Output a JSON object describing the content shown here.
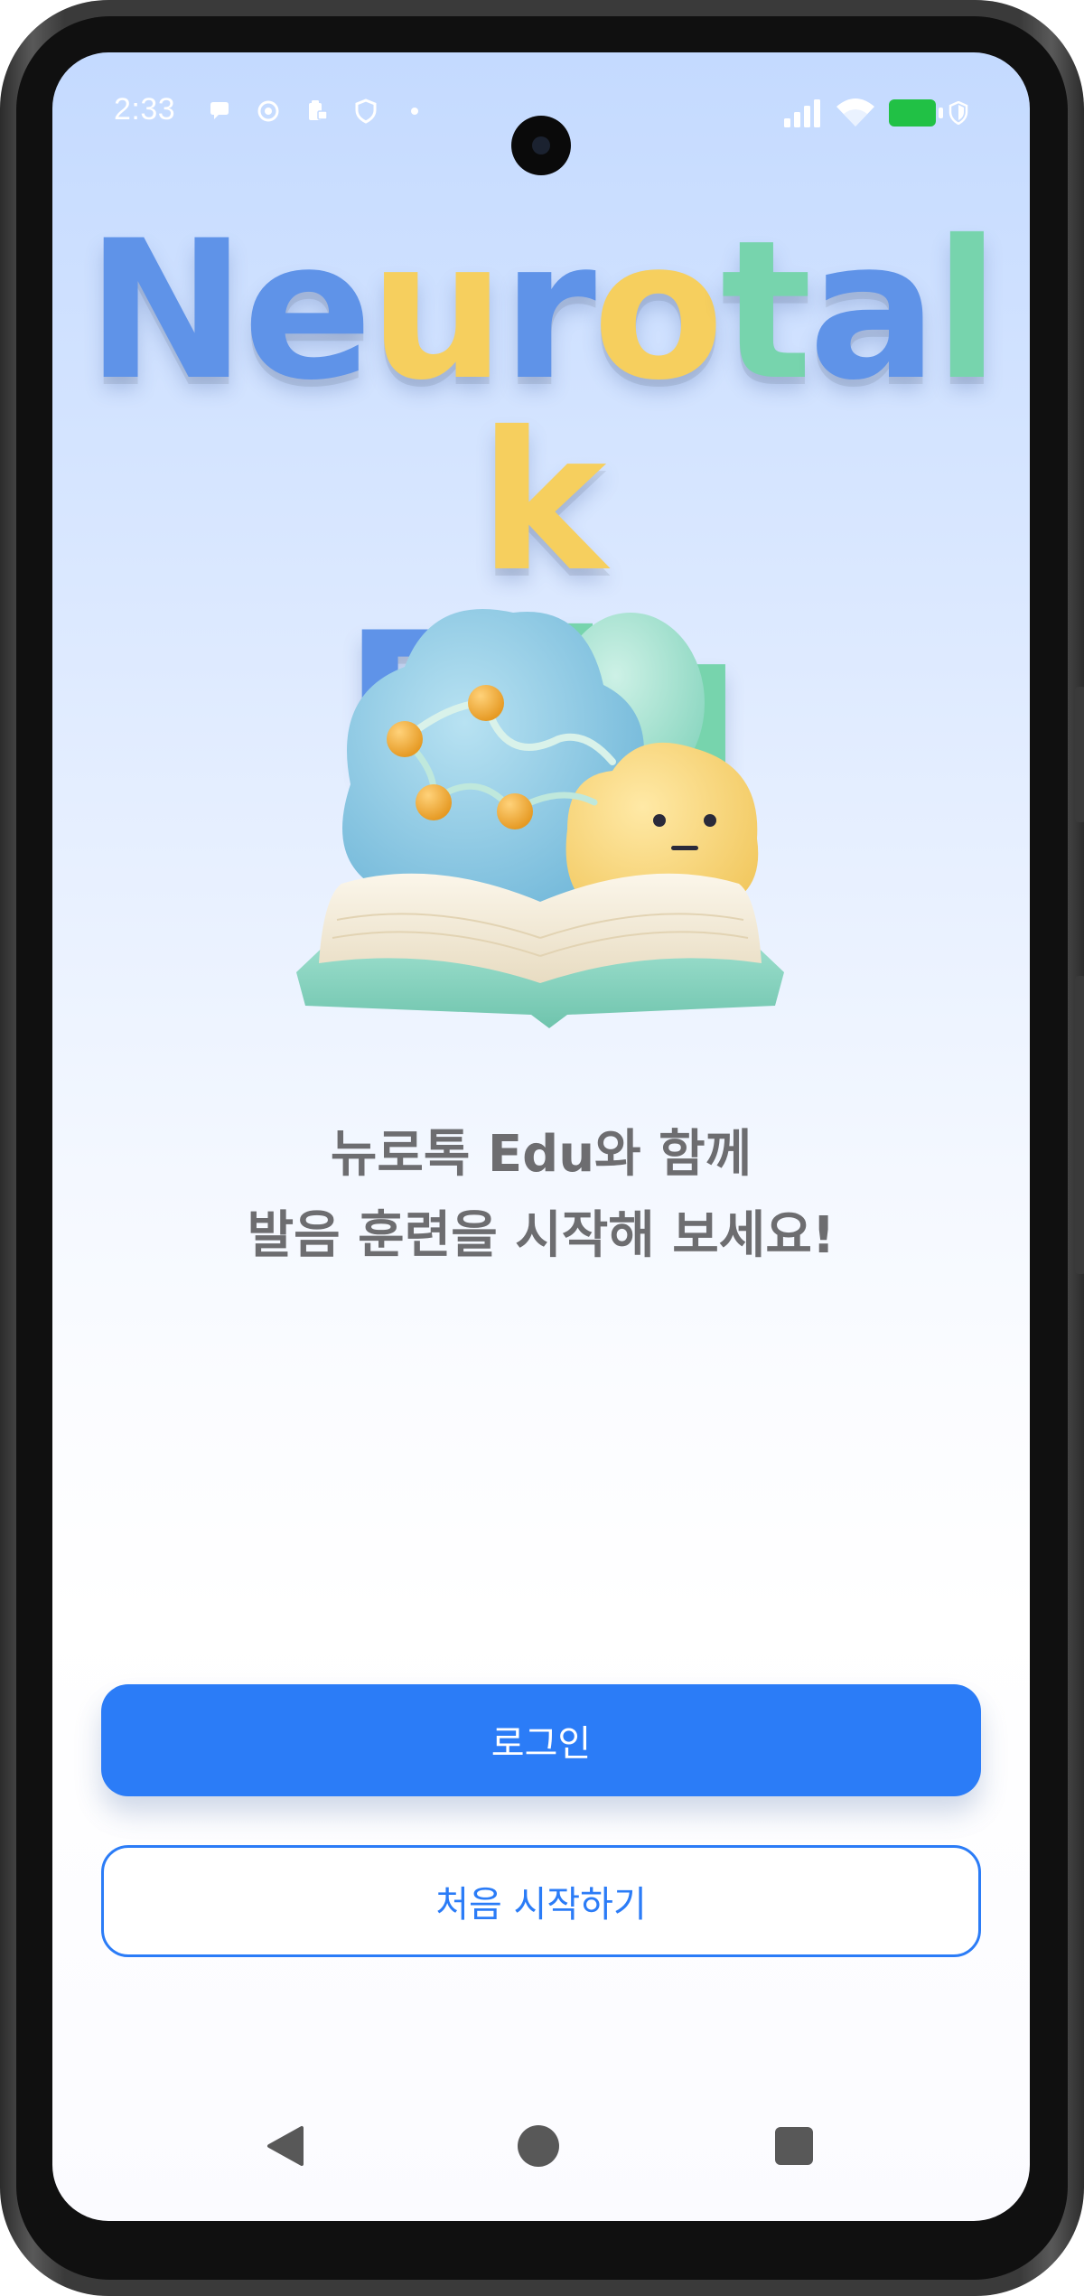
{
  "status_bar": {
    "time": "2:33"
  },
  "logo": {
    "line1": [
      "N",
      "e",
      "u",
      "r",
      "o",
      "t",
      "a",
      "l",
      "k"
    ],
    "line1_colors": [
      "blue",
      "blue",
      "yellow",
      "blue",
      "yellow",
      "green",
      "blue",
      "green",
      "yellow"
    ],
    "line2": [
      "E",
      "d",
      "u"
    ],
    "line2_colors": [
      "blue",
      "green",
      "green"
    ]
  },
  "tagline": {
    "line1": "뉴로톡 Edu와 함께",
    "line2": "발음 훈련을 시작해 보세요!"
  },
  "buttons": {
    "login_label": "로그인",
    "start_label": "처음 시작하기"
  },
  "colors": {
    "accent": "#2b7cf7",
    "logo_blue": "#5f93e8",
    "logo_yellow": "#f6cf5e",
    "logo_green": "#77d4ad",
    "tagline": "#6d6d70",
    "battery": "#21c145"
  },
  "icons": {
    "status_left": [
      "chat-bubble-icon",
      "at-sign-icon",
      "clipboard-lock-icon",
      "shield-icon",
      "dot-icon"
    ],
    "status_right": [
      "signal-icon",
      "wifi-icon",
      "battery-icon",
      "shield-small-icon"
    ],
    "nav": [
      "back-icon",
      "home-icon",
      "recents-icon"
    ]
  }
}
